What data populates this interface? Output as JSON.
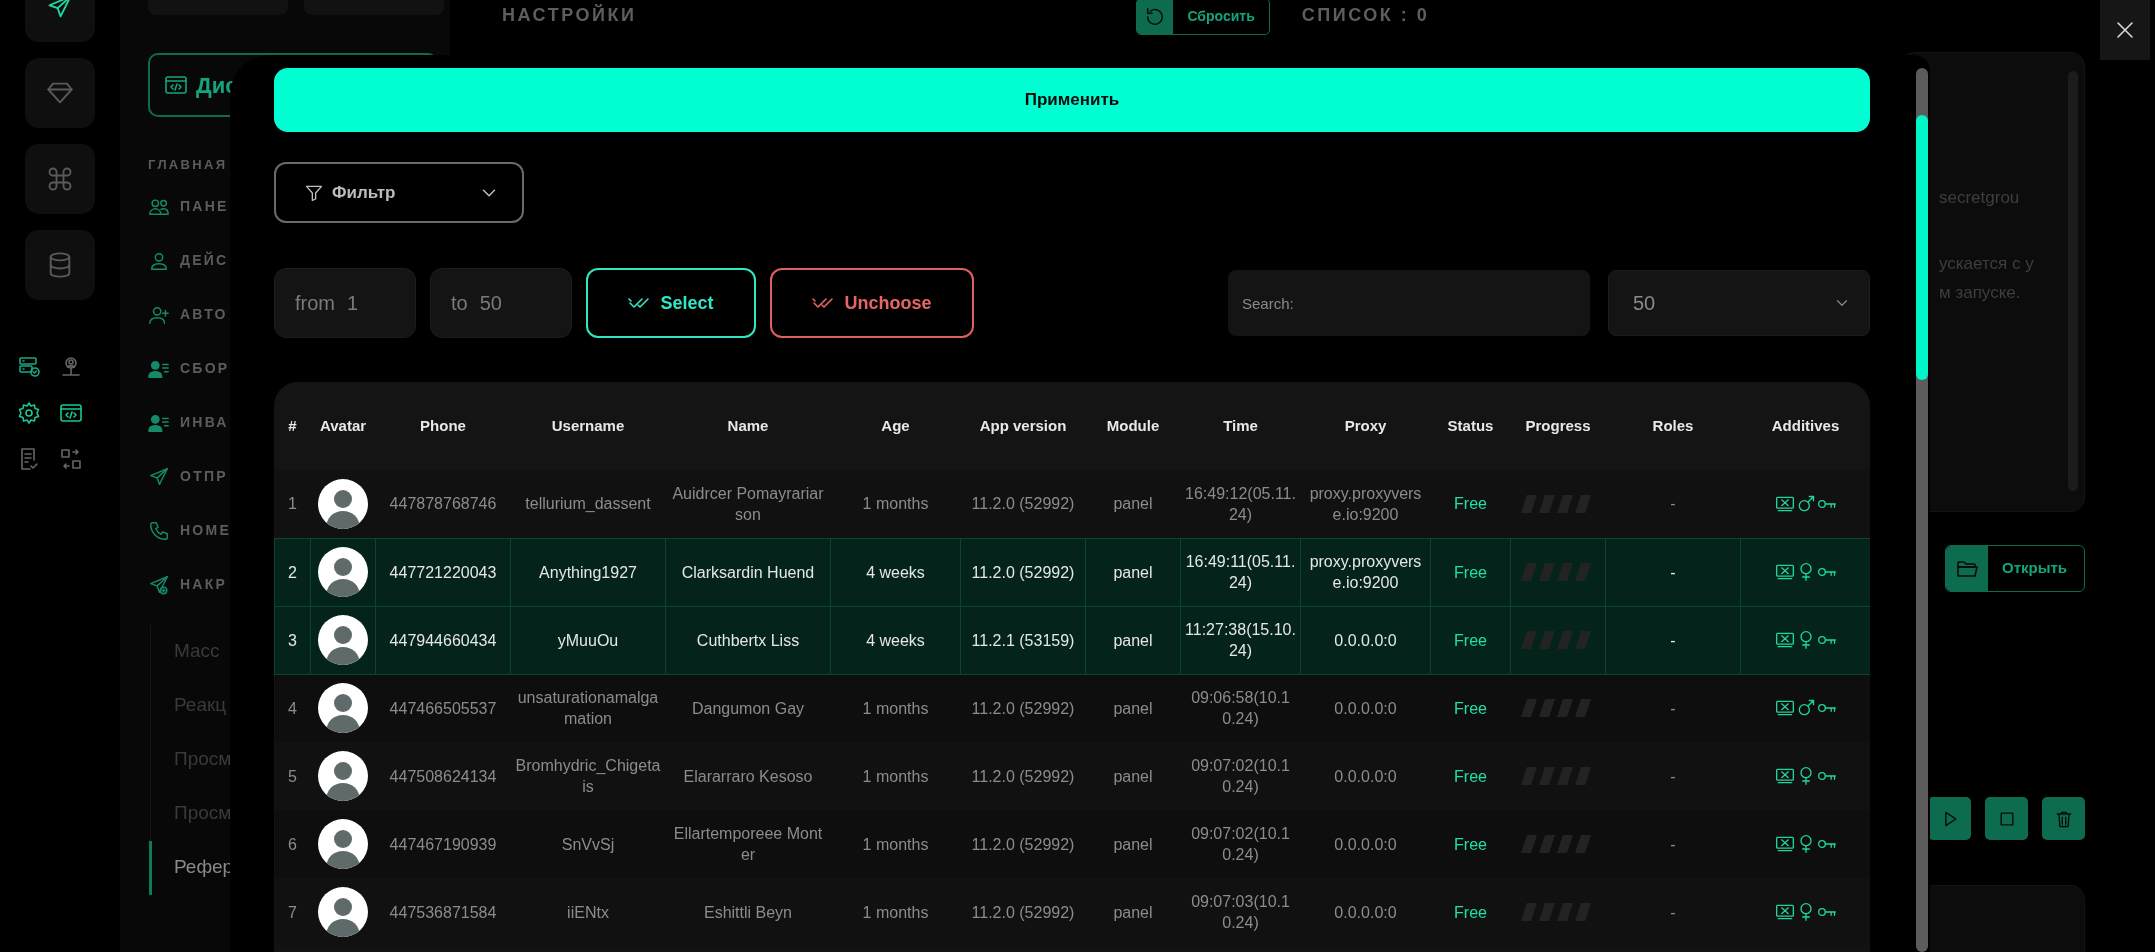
{
  "header": {
    "title": "НАСТРОЙКИ",
    "reset_button": "Сбросить",
    "list_count": "СПИСОК : 0"
  },
  "sidebar": {
    "button": "Дис",
    "section": "ГЛАВНАЯ",
    "items": [
      {
        "label": "ПАНЕ",
        "kind": "people"
      },
      {
        "label": "ДЕЙС",
        "kind": "person"
      },
      {
        "label": "АВТО",
        "kind": "person-plus"
      },
      {
        "label": "СБОР",
        "kind": "person-list"
      },
      {
        "label": "ИНВА",
        "kind": "person-list"
      },
      {
        "label": "ОТПР",
        "kind": "send"
      },
      {
        "label": "НОМЕ",
        "kind": "phone"
      },
      {
        "label": "НАКР",
        "kind": "send-plus"
      }
    ],
    "subitems": [
      {
        "label": "Масс",
        "selected": false
      },
      {
        "label": "Реакц",
        "selected": false
      },
      {
        "label": "Просм",
        "selected": false
      },
      {
        "label": "Просм",
        "selected": false
      },
      {
        "label": "Рефер",
        "selected": true
      }
    ]
  },
  "right_panel": {
    "lines": [
      "secretgrou",
      "ускается с у",
      "м запуске."
    ],
    "open_button": "Открыть"
  },
  "modal": {
    "apply_button": "Применить",
    "filter_button": "Фильтр",
    "from": {
      "label": "from",
      "value": "1"
    },
    "to": {
      "label": "to",
      "value": "50"
    },
    "select_button": "Select",
    "unchoose_button": "Unchoose",
    "search": {
      "placeholder": "Search:"
    },
    "page_size": "50",
    "table": {
      "columns": [
        "#",
        "Avatar",
        "Phone",
        "Username",
        "Name",
        "Age",
        "App version",
        "Module",
        "Time",
        "Proxy",
        "Status",
        "Progress",
        "Roles",
        "Additives"
      ],
      "rows": [
        {
          "index": "1",
          "phone": "447878768746",
          "username": "tellurium_dassent",
          "name": "Auidrcer Pomayrariarson",
          "age": "1 months",
          "app_version": "11.2.0 (52992)",
          "module": "panel",
          "time": "16:49:12(05.11.24)",
          "proxy": "proxy.proxyverse.io:9200",
          "status": "Free",
          "roles": "-",
          "male": true,
          "selected": false
        },
        {
          "index": "2",
          "phone": "447721220043",
          "username": "Anything1927",
          "name": "Clarksardin Huend",
          "age": "4 weeks",
          "app_version": "11.2.0 (52992)",
          "module": "panel",
          "time": "16:49:11(05.11.24)",
          "proxy": "proxy.proxyverse.io:9200",
          "status": "Free",
          "roles": "-",
          "male": false,
          "selected": true
        },
        {
          "index": "3",
          "phone": "447944660434",
          "username": "yMuuOu",
          "name": "Cuthbertx Liss",
          "age": "4 weeks",
          "app_version": "11.2.1 (53159)",
          "module": "panel",
          "time": "11:27:38(15.10.24)",
          "proxy": "0.0.0.0:0",
          "status": "Free",
          "roles": "-",
          "male": false,
          "selected": true
        },
        {
          "index": "4",
          "phone": "447466505537",
          "username": "unsaturationamalgamation",
          "name": "Dangumon Gay",
          "age": "1 months",
          "app_version": "11.2.0 (52992)",
          "module": "panel",
          "time": "09:06:58(10.10.24)",
          "proxy": "0.0.0.0:0",
          "status": "Free",
          "roles": "-",
          "male": true,
          "selected": false
        },
        {
          "index": "5",
          "phone": "447508624134",
          "username": "Bromhydric_Chigetais",
          "name": "Elararraro Kesoso",
          "age": "1 months",
          "app_version": "11.2.0 (52992)",
          "module": "panel",
          "time": "09:07:02(10.10.24)",
          "proxy": "0.0.0.0:0",
          "status": "Free",
          "roles": "-",
          "male": false,
          "selected": false
        },
        {
          "index": "6",
          "phone": "447467190939",
          "username": "SnVvSj",
          "name": "Ellartemporeee Monter",
          "age": "1 months",
          "app_version": "11.2.0 (52992)",
          "module": "panel",
          "time": "09:07:02(10.10.24)",
          "proxy": "0.0.0.0:0",
          "status": "Free",
          "roles": "-",
          "male": false,
          "selected": false
        },
        {
          "index": "7",
          "phone": "447536871584",
          "username": "iiENtx",
          "name": "Eshittli Beyn",
          "age": "1 months",
          "app_version": "11.2.0 (52992)",
          "module": "panel",
          "time": "09:07:03(10.10.24)",
          "proxy": "0.0.0.0:0",
          "status": "Free",
          "roles": "-",
          "male": false,
          "selected": false
        }
      ]
    }
  }
}
